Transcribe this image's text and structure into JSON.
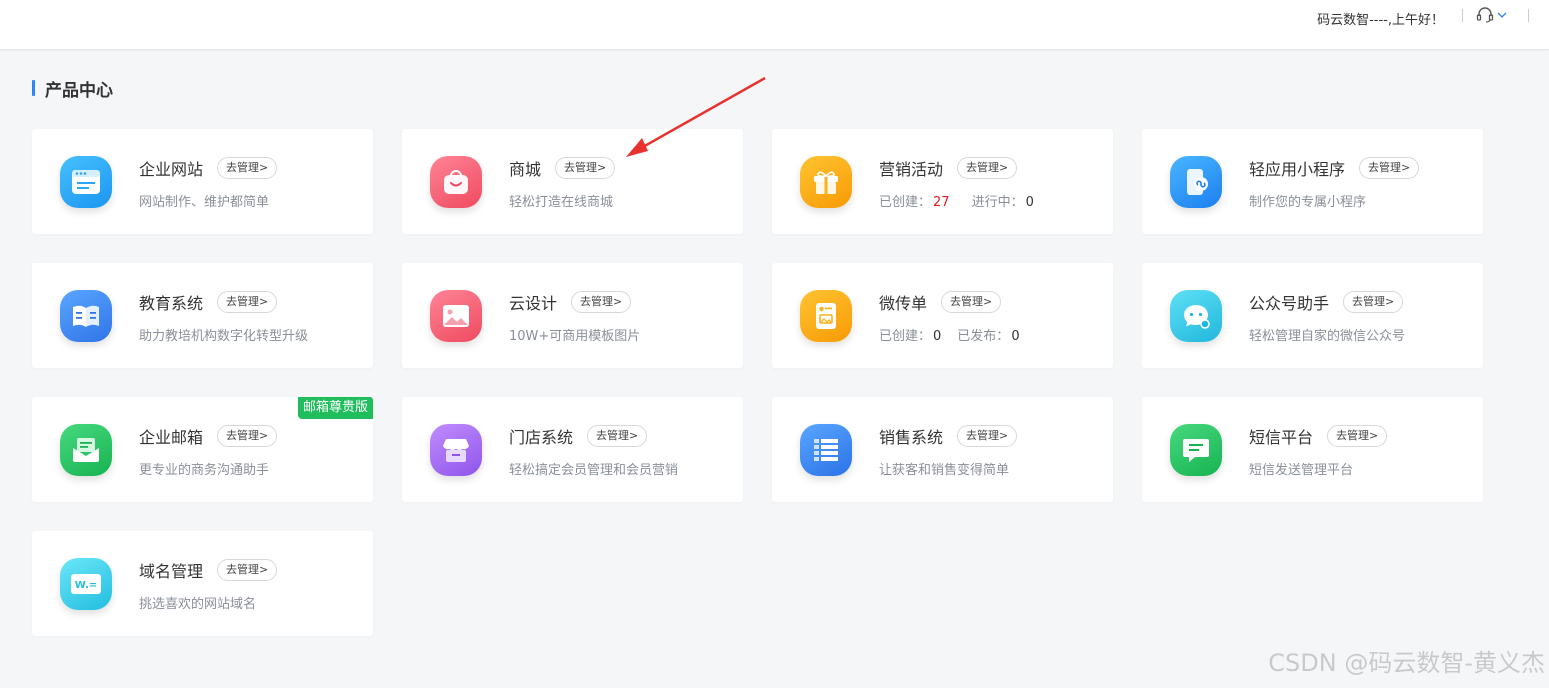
{
  "header": {
    "greeting": "码云数智----,上午好！"
  },
  "section": {
    "title": "产品中心"
  },
  "manage_label": "去管理>",
  "cards": [
    {
      "name": "企业网站",
      "desc": "网站制作、维护都简单",
      "icon": "website-icon",
      "color": "#2aa6f5"
    },
    {
      "name": "商城",
      "desc": "轻松打造在线商城",
      "icon": "shopping-bag-icon",
      "color": "#f3596b"
    },
    {
      "name": "营销活动",
      "created_label": "已创建：",
      "created_value": "27",
      "running_label": "进行中：",
      "running_value": "0",
      "icon": "gift-icon",
      "color": "#fba90d"
    },
    {
      "name": "轻应用小程序",
      "desc": "制作您的专属小程序",
      "icon": "mini-program-icon",
      "color": "#2f95f5"
    },
    {
      "name": "教育系统",
      "desc": "助力教培机构数字化转型升级",
      "icon": "book-icon",
      "color": "#3c8cf0"
    },
    {
      "name": "云设计",
      "desc": "10W+可商用模板图片",
      "icon": "image-icon",
      "color": "#f3596b"
    },
    {
      "name": "微传单",
      "created_label": "已创建：",
      "created_value": "0",
      "published_label": "已发布：",
      "published_value": "0",
      "icon": "flyer-icon",
      "color": "#fba90d"
    },
    {
      "name": "公众号助手",
      "desc": "轻松管理自家的微信公众号",
      "icon": "wechat-chat-icon",
      "color": "#2fc0e0"
    },
    {
      "name": "企业邮箱",
      "desc": "更专业的商务沟通助手",
      "badge": "邮箱尊贵版",
      "icon": "mail-icon",
      "color": "#1fbd5c"
    },
    {
      "name": "门店系统",
      "desc": "轻松搞定会员管理和会员营销",
      "icon": "store-icon",
      "color": "#a36cf0"
    },
    {
      "name": "销售系统",
      "desc": "让获客和销售变得简单",
      "icon": "list-icon",
      "color": "#2f86f6"
    },
    {
      "name": "短信平台",
      "desc": "短信发送管理平台",
      "icon": "sms-icon",
      "color": "#1fbd5c"
    },
    {
      "name": "域名管理",
      "desc": "挑选喜欢的网站域名",
      "icon": "domain-icon",
      "color": "#2fc0e0",
      "icon_text": "W.="
    }
  ],
  "watermark": "CSDN @码云数智-黄义杰"
}
